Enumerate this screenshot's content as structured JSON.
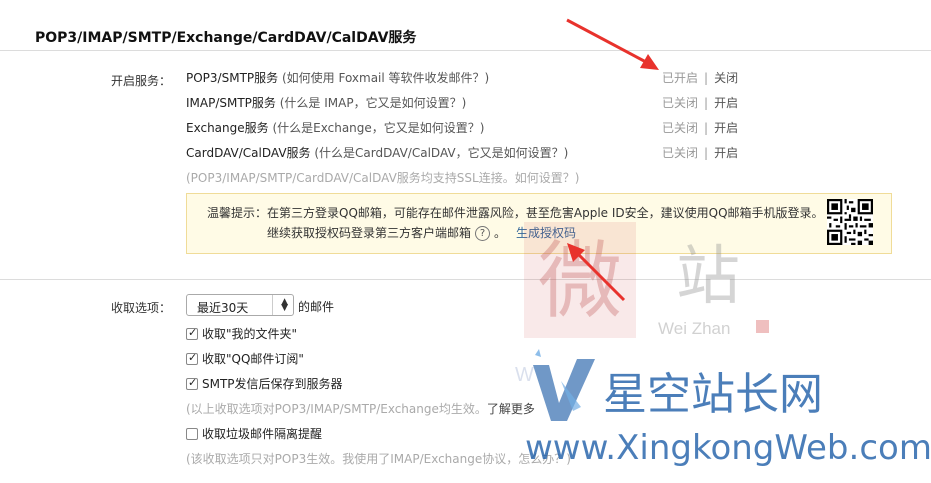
{
  "section_title": "POP3/IMAP/SMTP/Exchange/CardDAV/CalDAV服务",
  "services_label": "开启服务：",
  "services": [
    {
      "name": "POP3/SMTP服务",
      "hint": "(如何使用 Foxmail 等软件收发邮件？)",
      "status": "已开启",
      "action": "关闭"
    },
    {
      "name": "IMAP/SMTP服务",
      "hint": "(什么是 IMAP，它又是如何设置？)",
      "status": "已关闭",
      "action": "开启"
    },
    {
      "name": "Exchange服务",
      "hint": "(什么是Exchange，它又是如何设置？)",
      "status": "已关闭",
      "action": "开启"
    },
    {
      "name": "CardDAV/CalDAV服务",
      "hint": "(什么是CardDAV/CalDAV，它又是如何设置？)",
      "status": "已关闭",
      "action": "开启"
    }
  ],
  "status_separator": "|",
  "ssl_note": "(POP3/IMAP/SMTP/CardDAV/CalDAV服务均支持SSL连接。如何设置？)",
  "warning": {
    "line1": "温馨提示：在第三方登录QQ邮箱，可能存在邮件泄露风险，甚至危害Apple ID安全，建议使用QQ邮箱手机版登录。",
    "line2": "继续获取授权码登录第三方客户端邮箱",
    "help_glyph": "?",
    "after_help": "。",
    "generate_link": "生成授权码"
  },
  "receive_label": "收取选项：",
  "receive_select": {
    "value": "最近30天",
    "suffix": "的邮件"
  },
  "options": [
    {
      "label": "收取\"我的文件夹\"",
      "checked": true
    },
    {
      "label": "收取\"QQ邮件订阅\"",
      "checked": true
    },
    {
      "label": "SMTP发信后保存到服务器",
      "checked": true
    }
  ],
  "exchange_note": "(以上收取选项对POP3/IMAP/SMTP/Exchange均生效。",
  "exchange_note_link": "了解更多",
  "spam_option": {
    "label": "收取垃圾邮件隔离提醒",
    "checked": false
  },
  "pop3_note": "(该收取选项只对POP3生效。我使用了IMAP/Exchange协议，怎么办？)",
  "watermark": {
    "wz_char1": "微",
    "wz_char2": "站",
    "wz_latin": "Wei Zhan",
    "xk_cn": "星空站长网",
    "xk_url": "www.XingkongWeb.com",
    "xk_faint": "W"
  },
  "colors": {
    "arrow": "#e8322c",
    "warn_bg": "#fffbe6",
    "watermark_blue": "#1f5ea8"
  }
}
